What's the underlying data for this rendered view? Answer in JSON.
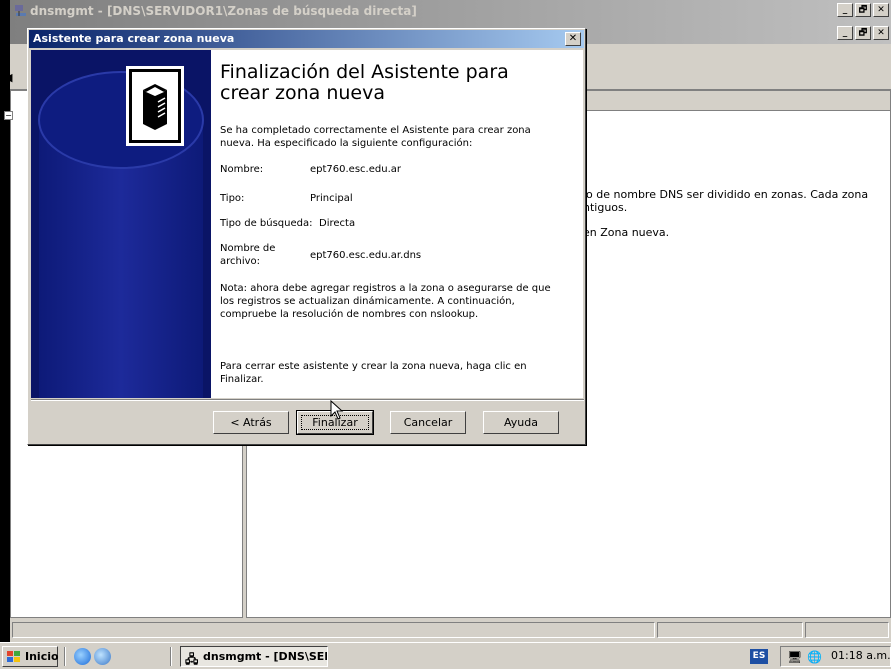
{
  "main_window": {
    "title": "dnsmgmt - [DNS\\SERVIDOR1\\Zonas de búsqueda directa]",
    "controls": [
      "_",
      "🗗",
      "✕"
    ]
  },
  "right_pane": {
    "line1": "io de nombre DNS ser dividido en zonas. Cada zona",
    "line2": "ntiguos.",
    "line3": "en Zona nueva."
  },
  "wizard": {
    "title": "Asistente para crear zona nueva",
    "close": "✕",
    "heading": "Finalización del Asistente para crear zona nueva",
    "intro": "Se ha completado correctamente el Asistente para crear zona nueva. Ha especificado la siguiente configuración:",
    "fields": [
      {
        "label": "Nombre:",
        "value": "ept760.esc.edu.ar"
      },
      {
        "label": "Tipo:",
        "value": "Principal"
      },
      {
        "label": "Tipo de búsqueda:",
        "value": "Directa"
      },
      {
        "label": "Nombre de archivo:",
        "value": "ept760.esc.edu.ar.dns"
      }
    ],
    "note": "Nota: ahora debe agregar registros a la zona o asegurarse de que los registros se actualizan dinámicamente. A continuación, compruebe la resolución de nombres con nslookup.",
    "finish_text": "Para cerrar este asistente y crear la zona nueva, haga clic en Finalizar.",
    "buttons": {
      "back": "< Atrás",
      "finish": "Finalizar",
      "cancel": "Cancelar",
      "help": "Ayuda"
    }
  },
  "taskbar": {
    "start": "Inicio",
    "task": "dnsmgmt - [DNS\\SER...",
    "language": "ES",
    "clock": "01:18 a.m."
  }
}
